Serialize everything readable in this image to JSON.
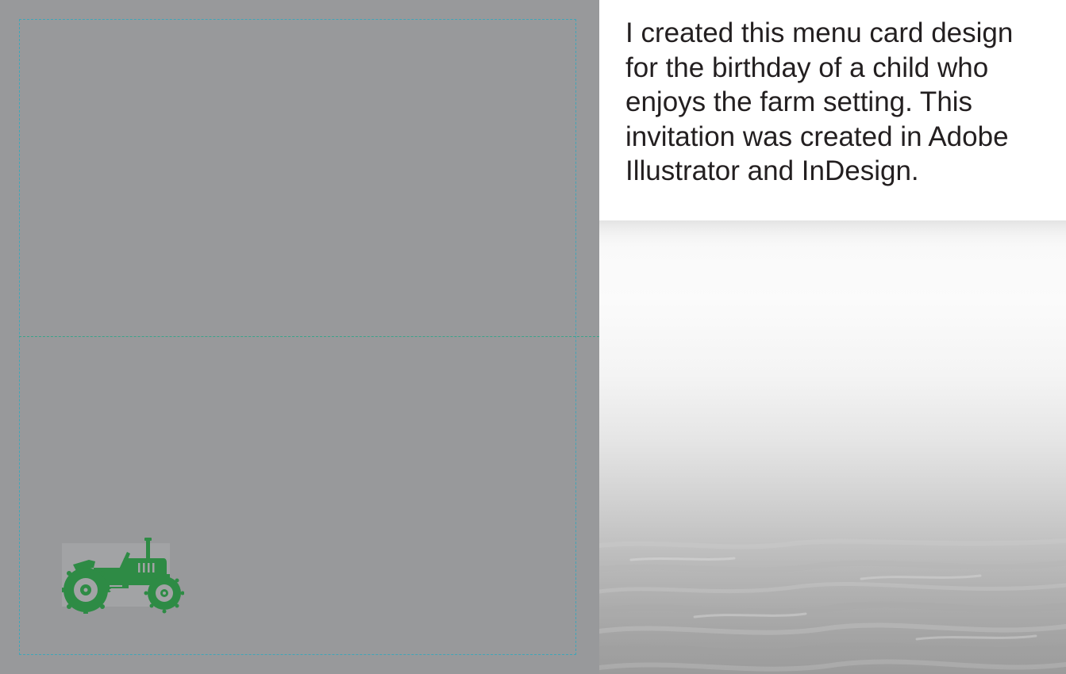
{
  "description": {
    "text": "I created this menu card design\nfor the birthday of a child who\nenjoys the farm setting.  This\ninvitation was created in Adobe\nIllustrator and InDesign."
  },
  "card": {
    "icon": "tractor-icon",
    "background_color": "#98999b",
    "icon_color": "#2e8b45",
    "guide_color": "#3fa6b8"
  },
  "photo": {
    "subject": "misty-water"
  }
}
